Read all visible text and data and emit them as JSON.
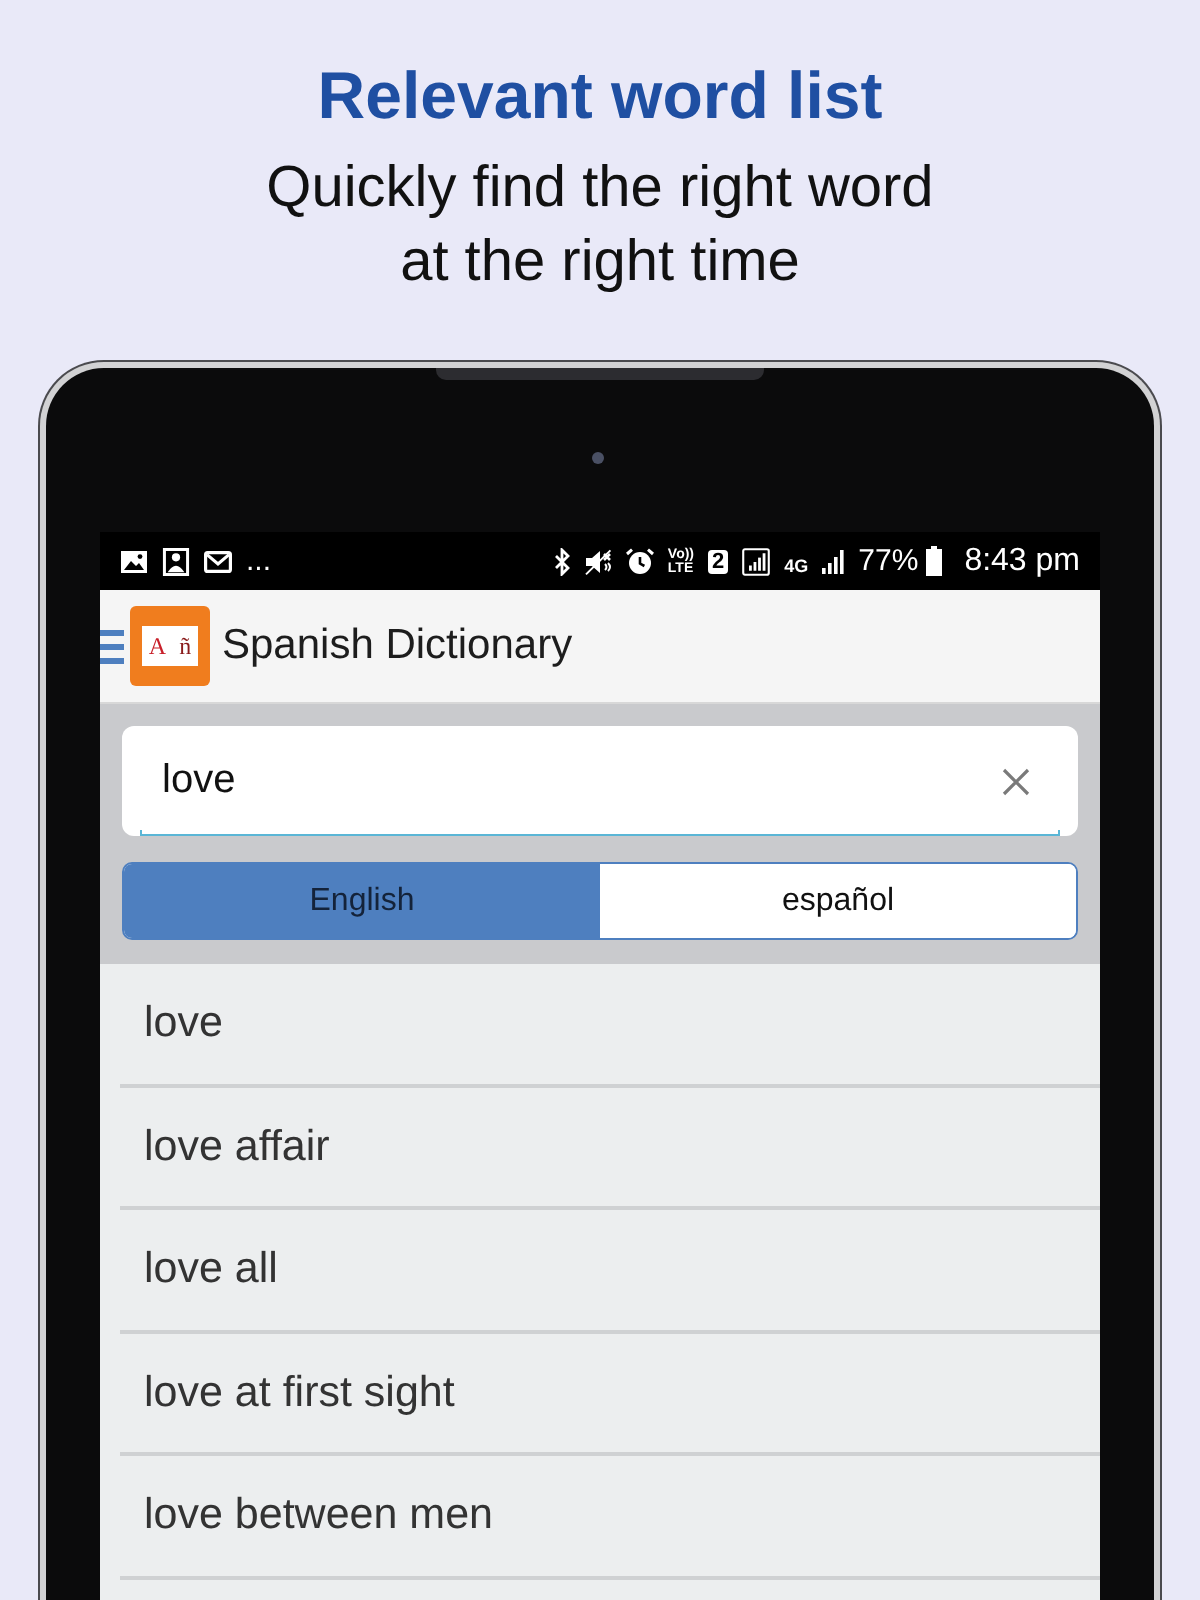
{
  "header": {
    "title": "Relevant word list",
    "subtitle": "Quickly find the right word at the right time"
  },
  "status_bar": {
    "overflow": "...",
    "volte": [
      "Vo))",
      "LTE"
    ],
    "sim_slot": "2",
    "network": "4G",
    "battery": "77%",
    "time": "8:43 pm"
  },
  "app_bar": {
    "icon_letters": [
      "A",
      "ñ"
    ],
    "title": "Spanish Dictionary"
  },
  "search": {
    "value": "love"
  },
  "language_tabs": [
    {
      "label": "English",
      "selected": true
    },
    {
      "label": "español",
      "selected": false
    }
  ],
  "results": [
    {
      "label": "love"
    },
    {
      "label": "love affair"
    },
    {
      "label": "love all"
    },
    {
      "label": "love at first sight"
    },
    {
      "label": "love between men"
    }
  ]
}
